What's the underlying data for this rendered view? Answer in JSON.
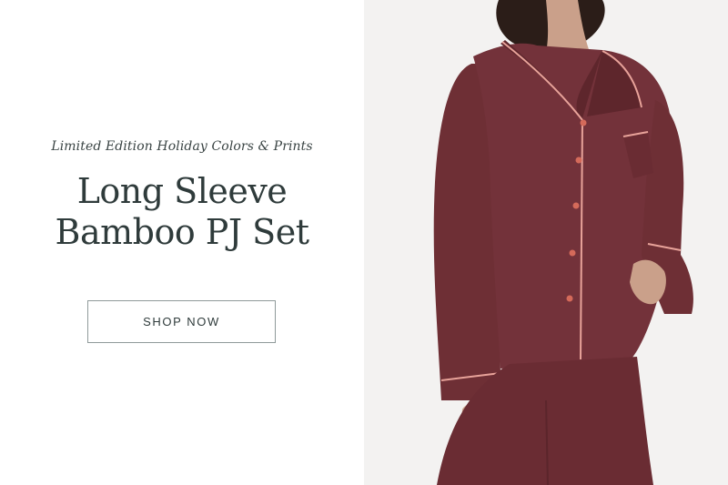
{
  "promo": {
    "eyebrow": "Limited Edition Holiday Colors & Prints",
    "title_line1": "Long Sleeve",
    "title_line2": "Bamboo PJ Set",
    "cta_label": "SHOP NOW"
  },
  "image": {
    "subject": "model wearing long sleeve bamboo pajama set",
    "garment_color": "#6e2f35",
    "piping_color": "#e8a39a",
    "background_color": "#f3f2f1"
  },
  "colors": {
    "text": "#2f3b3b",
    "button_border": "#8f9a9a"
  }
}
